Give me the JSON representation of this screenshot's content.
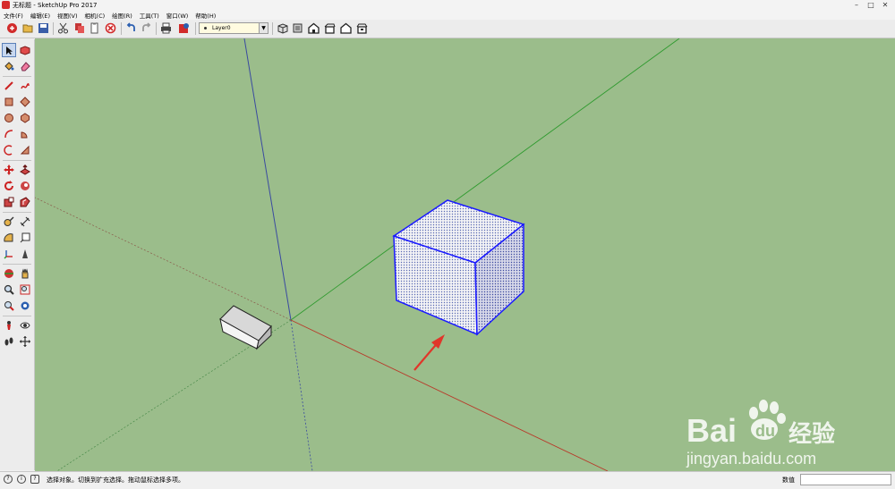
{
  "window": {
    "title": "无标题 - SketchUp Pro 2017",
    "controls": [
      "minimize-icon",
      "maximize-icon",
      "close-icon"
    ]
  },
  "menu": [
    "文件(F)",
    "编辑(E)",
    "视图(V)",
    "相机(C)",
    "绘图(R)",
    "工具(T)",
    "窗口(W)",
    "帮助(H)"
  ],
  "toolbar": {
    "icons": [
      "getting-started-icon",
      "open-icon",
      "save-icon",
      "cut-icon",
      "copy-icon",
      "paste-icon",
      "erase-icon",
      "undo-icon",
      "redo-icon",
      "print-icon",
      "model-info-icon"
    ],
    "view_icons": [
      "iso-view-icon",
      "top-view-icon",
      "front-view-icon",
      "right-view-icon",
      "back-view-icon",
      "left-view-icon"
    ]
  },
  "layer_select": {
    "value": "Layer0"
  },
  "left_tools": [
    "select-icon",
    "make-component-icon",
    "paint-bucket-icon",
    "eraser-icon",
    "line-icon",
    "freehand-icon",
    "rectangle-icon",
    "rotated-rectangle-icon",
    "circle-icon",
    "polygon-icon",
    "arc-icon",
    "pie-icon",
    "move-icon",
    "push-pull-icon",
    "rotate-icon",
    "follow-me-icon",
    "scale-icon",
    "offset-icon",
    "tape-measure-icon",
    "dimension-icon",
    "protractor-icon",
    "text-icon",
    "axes-icon",
    "3d-text-icon",
    "orbit-icon",
    "pan-icon",
    "zoom-icon",
    "zoom-window-icon",
    "zoom-extents-icon",
    "previous-icon",
    "position-camera-icon",
    "look-around-icon",
    "walk-icon",
    "section-plane-icon"
  ],
  "status": {
    "hint": "选择对象。切换到扩充选择。拖动鼠标选择多项。",
    "measure_label": "数值",
    "measure_value": ""
  },
  "watermark": {
    "logo": "Bai du 经验",
    "url": "jingyan.baidu.com"
  },
  "colors": {
    "viewport_bg": "#9bbd8b",
    "selection_blue": "#1a1aff",
    "axis_red": "#b83a2a",
    "axis_green": "#2e9a2e",
    "axis_blue": "#3a4aa0"
  }
}
